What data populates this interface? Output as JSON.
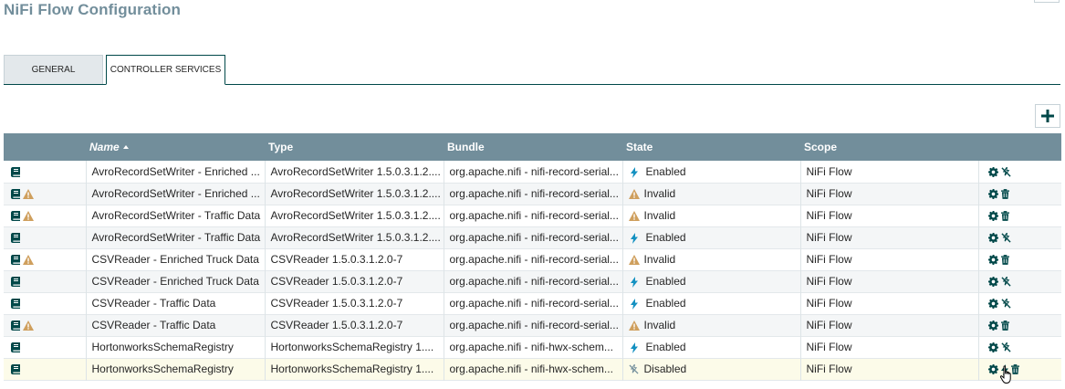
{
  "page": {
    "title": "NiFi Flow Configuration"
  },
  "tabs": [
    {
      "label": "GENERAL"
    },
    {
      "label": "CONTROLLER SERVICES"
    }
  ],
  "columns": {
    "name": "Name",
    "type": "Type",
    "bundle": "Bundle",
    "state": "State",
    "scope": "Scope"
  },
  "rows": [
    {
      "warn": false,
      "name": "AvroRecordSetWriter - Enriched ...",
      "type": "AvroRecordSetWriter 1.5.0.3.1.2....",
      "bundle": "org.apache.nifi - nifi-record-serial...",
      "state": "Enabled",
      "state_icon": "bolt-icon",
      "scope": "NiFi Flow",
      "actions": [
        "gear-icon",
        "disable-icon"
      ]
    },
    {
      "warn": true,
      "name": "AvroRecordSetWriter - Enriched ...",
      "type": "AvroRecordSetWriter 1.5.0.3.1.2....",
      "bundle": "org.apache.nifi - nifi-record-serial...",
      "state": "Invalid",
      "state_icon": "warning-icon",
      "scope": "NiFi Flow",
      "actions": [
        "gear-icon",
        "trash-icon"
      ]
    },
    {
      "warn": true,
      "name": "AvroRecordSetWriter - Traffic Data",
      "type": "AvroRecordSetWriter 1.5.0.3.1.2....",
      "bundle": "org.apache.nifi - nifi-record-serial...",
      "state": "Invalid",
      "state_icon": "warning-icon",
      "scope": "NiFi Flow",
      "actions": [
        "gear-icon",
        "trash-icon"
      ]
    },
    {
      "warn": false,
      "name": "AvroRecordSetWriter - Traffic Data",
      "type": "AvroRecordSetWriter 1.5.0.3.1.2....",
      "bundle": "org.apache.nifi - nifi-record-serial...",
      "state": "Enabled",
      "state_icon": "bolt-icon",
      "scope": "NiFi Flow",
      "actions": [
        "gear-icon",
        "disable-icon"
      ]
    },
    {
      "warn": true,
      "name": "CSVReader - Enriched Truck Data",
      "type": "CSVReader 1.5.0.3.1.2.0-7",
      "bundle": "org.apache.nifi - nifi-record-serial...",
      "state": "Invalid",
      "state_icon": "warning-icon",
      "scope": "NiFi Flow",
      "actions": [
        "gear-icon",
        "trash-icon"
      ]
    },
    {
      "warn": false,
      "name": "CSVReader - Enriched Truck Data",
      "type": "CSVReader 1.5.0.3.1.2.0-7",
      "bundle": "org.apache.nifi - nifi-record-serial...",
      "state": "Enabled",
      "state_icon": "bolt-icon",
      "scope": "NiFi Flow",
      "actions": [
        "gear-icon",
        "disable-icon"
      ]
    },
    {
      "warn": false,
      "name": "CSVReader - Traffic Data",
      "type": "CSVReader 1.5.0.3.1.2.0-7",
      "bundle": "org.apache.nifi - nifi-record-serial...",
      "state": "Enabled",
      "state_icon": "bolt-icon",
      "scope": "NiFi Flow",
      "actions": [
        "gear-icon",
        "disable-icon"
      ]
    },
    {
      "warn": true,
      "name": "CSVReader - Traffic Data",
      "type": "CSVReader 1.5.0.3.1.2.0-7",
      "bundle": "org.apache.nifi - nifi-record-serial...",
      "state": "Invalid",
      "state_icon": "warning-icon",
      "scope": "NiFi Flow",
      "actions": [
        "gear-icon",
        "trash-icon"
      ]
    },
    {
      "warn": false,
      "name": "HortonworksSchemaRegistry",
      "type": "HortonworksSchemaRegistry 1....",
      "bundle": "org.apache.nifi - nifi-hwx-schem...",
      "state": "Enabled",
      "state_icon": "bolt-icon",
      "scope": "NiFi Flow",
      "actions": [
        "gear-icon",
        "disable-icon"
      ]
    },
    {
      "warn": false,
      "name": "HortonworksSchemaRegistry",
      "type": "HortonworksSchemaRegistry 1....",
      "bundle": "org.apache.nifi - nifi-hwx-schem...",
      "state": "Disabled",
      "state_icon": "disabled-icon",
      "scope": "NiFi Flow",
      "actions": [
        "gear-icon",
        "bolt-icon",
        "trash-icon"
      ],
      "selected": true
    }
  ],
  "colors": {
    "header": "#728e9b",
    "title": "#728e9b",
    "action": "#004849",
    "bolt": "#1491c1",
    "warning": "#cf9f5d"
  }
}
